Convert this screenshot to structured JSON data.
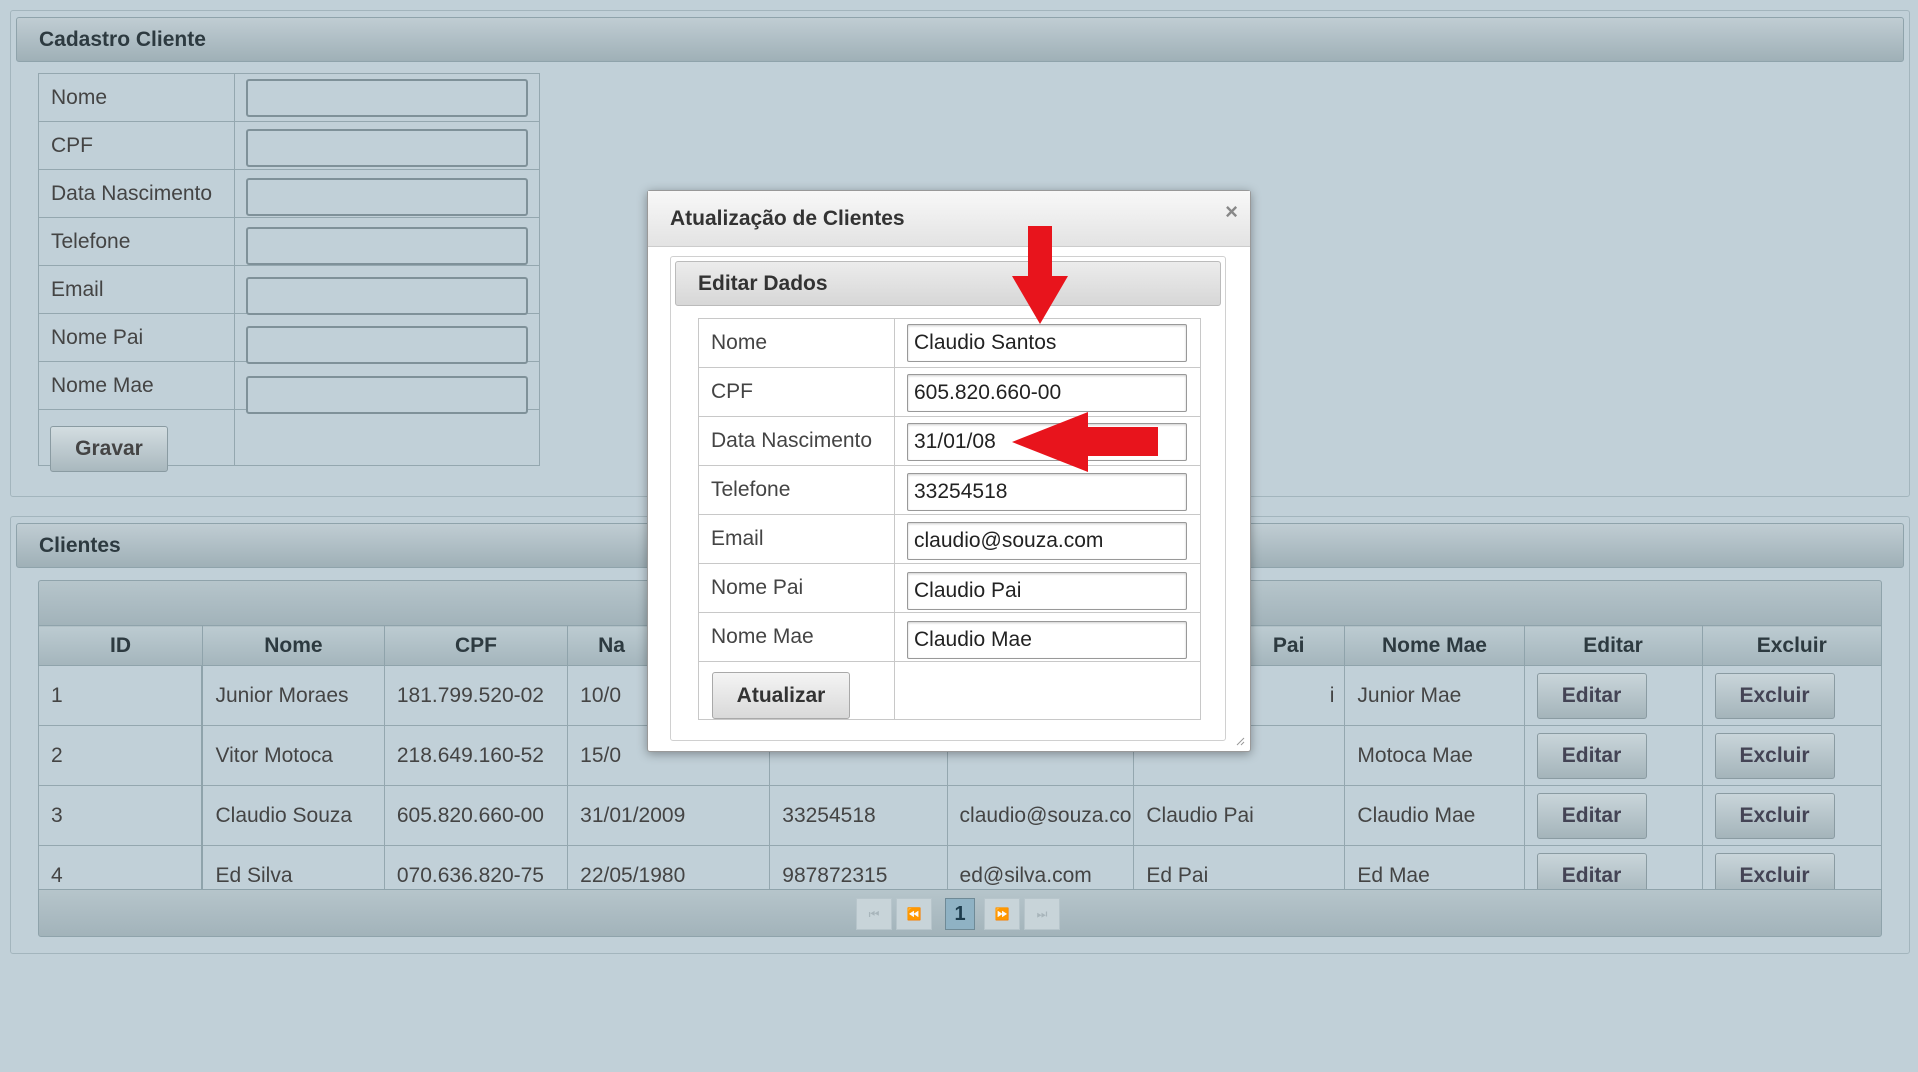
{
  "cadastro": {
    "title": "Cadastro Cliente",
    "labels": [
      "Nome",
      "CPF",
      "Data Nascimento",
      "Telefone",
      "Email",
      "Nome Pai",
      "Nome Mae"
    ],
    "save_label": "Gravar"
  },
  "clientes": {
    "title": "Clientes",
    "columns": [
      "ID",
      "Nome",
      "CPF",
      "Na",
      "",
      "",
      "Pai",
      "Nome Mae",
      "Editar",
      "Excluir"
    ],
    "rows": [
      {
        "id": "1",
        "nome": "Junior Moraes",
        "cpf": "181.799.520-02",
        "nasc": "10/0",
        "tel": "",
        "email": "",
        "pai": "i",
        "mae": "Junior Mae"
      },
      {
        "id": "2",
        "nome": "Vitor Motoca",
        "cpf": "218.649.160-52",
        "nasc": "15/0",
        "tel": "",
        "email": "",
        "pai": "",
        "mae": "Motoca Mae"
      },
      {
        "id": "3",
        "nome": "Claudio Souza",
        "cpf": "605.820.660-00",
        "nasc": "31/01/2009",
        "tel": "33254518",
        "email": "claudio@souza.co",
        "pai": "Claudio Pai",
        "mae": "Claudio Mae"
      },
      {
        "id": "4",
        "nome": "Ed Silva",
        "cpf": "070.636.820-75",
        "nasc": "22/05/1980",
        "tel": "987872315",
        "email": "ed@silva.com",
        "pai": "Ed Pai",
        "mae": "Ed Mae"
      }
    ],
    "edit_label": "Editar",
    "delete_label": "Excluir",
    "pager": {
      "current_page": "1",
      "first": "⏮",
      "prev": "⏪",
      "next": "⏩",
      "last": "⏭"
    }
  },
  "dialog": {
    "title": "Atualização de Clientes",
    "close_icon": "×",
    "panel_title": "Editar Dados",
    "fields": [
      {
        "label": "Nome",
        "value": "Claudio Santos"
      },
      {
        "label": "CPF",
        "value": "605.820.660-00"
      },
      {
        "label": "Data Nascimento",
        "value": "31/01/08"
      },
      {
        "label": "Telefone",
        "value": "33254518"
      },
      {
        "label": "Email",
        "value": "claudio@souza.com"
      },
      {
        "label": "Nome Pai",
        "value": "Claudio Pai"
      },
      {
        "label": "Nome Mae",
        "value": "Claudio Mae"
      }
    ],
    "update_label": "Atualizar"
  },
  "annotations": {
    "arrow_color": "#e8141c"
  }
}
